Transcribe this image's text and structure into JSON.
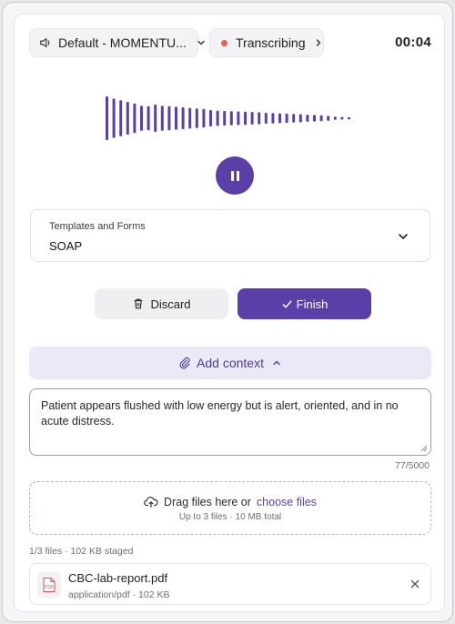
{
  "topbar": {
    "device_label": "Default - MOMENTU...",
    "status_label": "Transcribing",
    "timer": "00:04"
  },
  "waveform": {
    "levels": [
      0.8,
      0.72,
      0.66,
      0.6,
      0.54,
      0.46,
      0.44,
      0.5,
      0.46,
      0.44,
      0.42,
      0.4,
      0.38,
      0.36,
      0.34,
      0.3,
      0.28,
      0.27,
      0.26,
      0.25,
      0.24,
      0.23,
      0.22,
      0.2,
      0.19,
      0.18,
      0.17,
      0.16,
      0.15,
      0.13,
      0.12,
      0.11,
      0.09,
      0.06,
      0.05,
      0.04
    ],
    "color": "#5b3fa8"
  },
  "template": {
    "label": "Templates and Forms",
    "value": "SOAP"
  },
  "actions": {
    "discard_label": "Discard",
    "finish_label": "Finish"
  },
  "context": {
    "toggle_label": "Add context",
    "note_text": "Patient appears flushed with low energy but is alert, oriented, and in no acute distress.",
    "char_count": "77/5000"
  },
  "upload": {
    "drag_text": "Drag files here or",
    "choose_text": "choose files",
    "limits": "Up to 3 files · 10 MB total",
    "staged": "1/3 files · 102 KB staged"
  },
  "files": [
    {
      "name": "CBC-lab-report.pdf",
      "meta": "application/pdf · 102 KB",
      "badge": "PDF"
    }
  ],
  "colors": {
    "accent": "#5b3fa8",
    "accent_soft": "#ece8f8",
    "recording_dot": "#ef5b5b"
  }
}
